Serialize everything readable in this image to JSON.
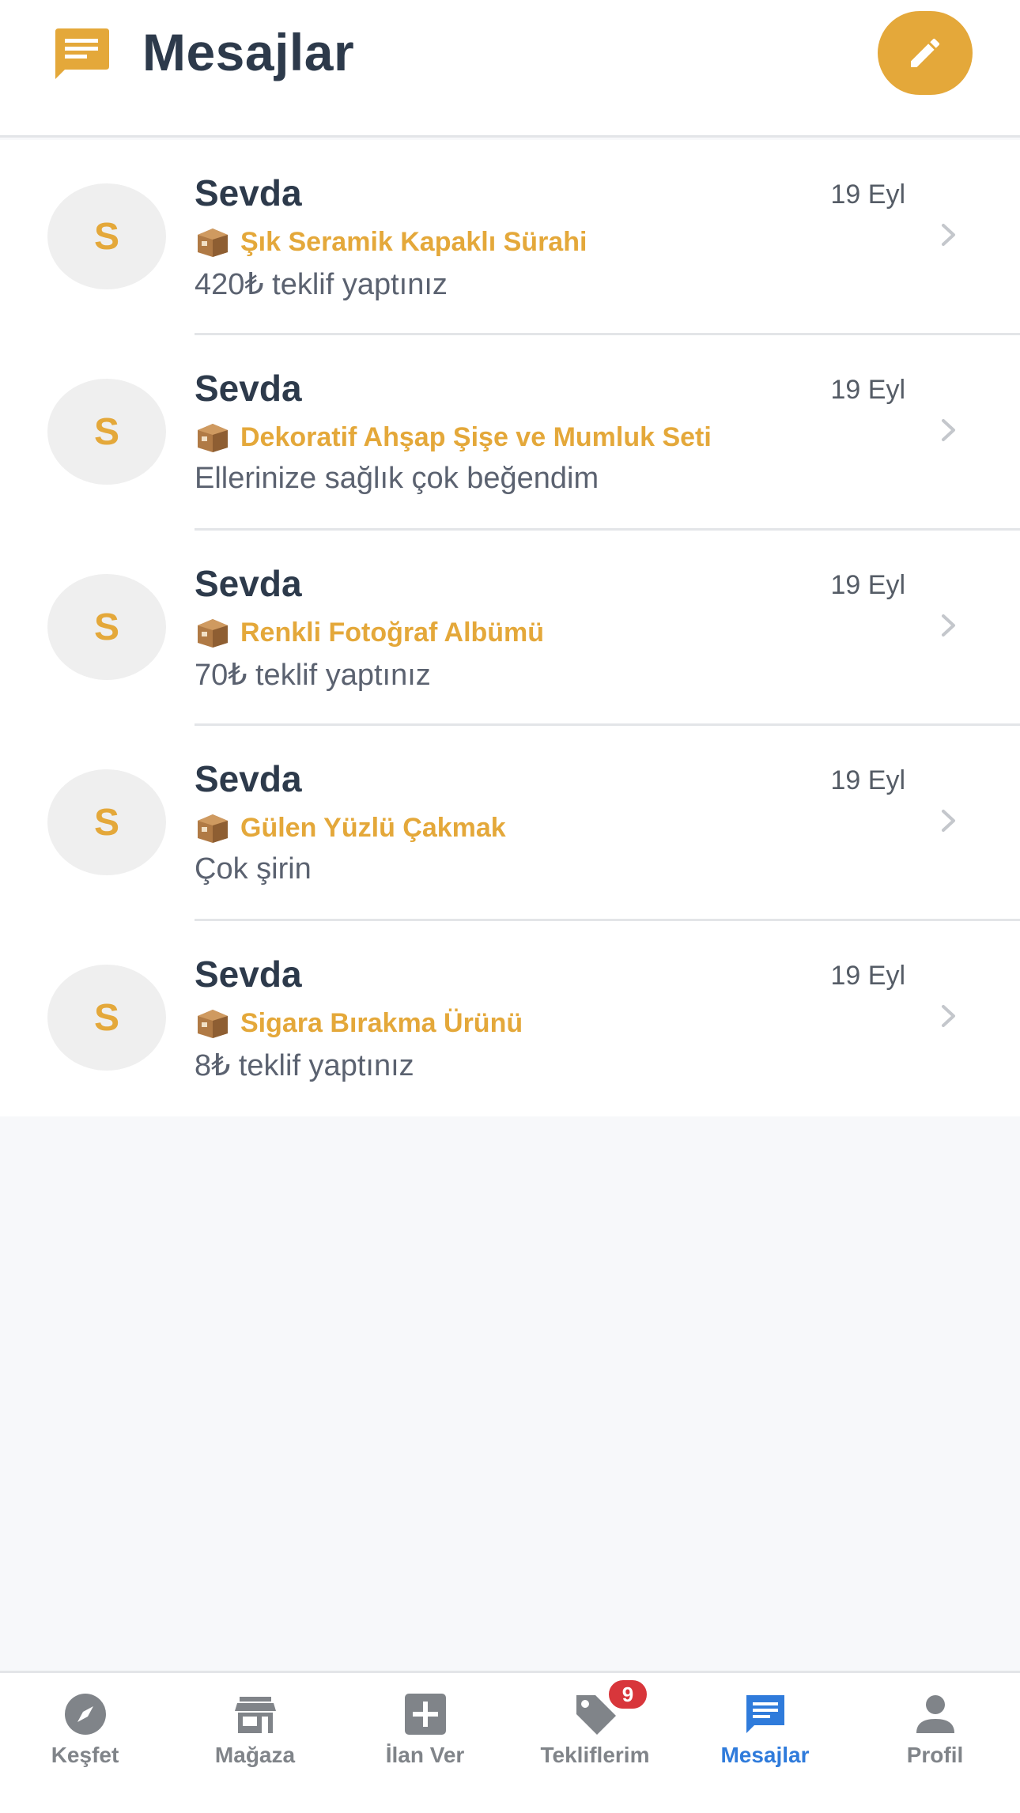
{
  "header": {
    "title": "Mesajlar",
    "icon": "chat-icon",
    "compose_icon": "pencil-icon"
  },
  "conversations": [
    {
      "avatar": "S",
      "name": "Sevda",
      "date": "19 Eyl",
      "product_icon": "package-icon",
      "product": "Şık Seramik Kapaklı Sürahi",
      "preview": "420₺ teklif yaptınız"
    },
    {
      "avatar": "S",
      "name": "Sevda",
      "date": "19 Eyl",
      "product_icon": "package-icon",
      "product": "Dekoratif Ahşap Şişe ve Mumluk Seti",
      "preview": "Ellerinize sağlık çok beğendim"
    },
    {
      "avatar": "S",
      "name": "Sevda",
      "date": "19 Eyl",
      "product_icon": "package-icon",
      "product": "Renkli Fotoğraf Albümü",
      "preview": "70₺ teklif yaptınız"
    },
    {
      "avatar": "S",
      "name": "Sevda",
      "date": "19 Eyl",
      "product_icon": "package-icon",
      "product": "Gülen Yüzlü Çakmak",
      "preview": "Çok şirin"
    },
    {
      "avatar": "S",
      "name": "Sevda",
      "date": "19 Eyl",
      "product_icon": "package-icon",
      "product": "Sigara Bırakma Ürünü",
      "preview": "8₺ teklif yaptınız"
    }
  ],
  "tabbar": {
    "tabs": [
      {
        "label": "Keşfet",
        "icon": "compass-icon"
      },
      {
        "label": "Mağaza",
        "icon": "store-icon"
      },
      {
        "label": "İlan Ver",
        "icon": "plus-box-icon"
      },
      {
        "label": "Tekliflerim",
        "icon": "tag-icon",
        "badge": "9"
      },
      {
        "label": "Mesajlar",
        "icon": "message-icon",
        "active": true
      },
      {
        "label": "Profil",
        "icon": "person-icon"
      }
    ]
  },
  "colors": {
    "accent": "#e4a83a",
    "title": "#2d3a4b",
    "active_tab": "#2f7bdb",
    "inactive_tab": "#808489",
    "badge": "#d8363b"
  }
}
